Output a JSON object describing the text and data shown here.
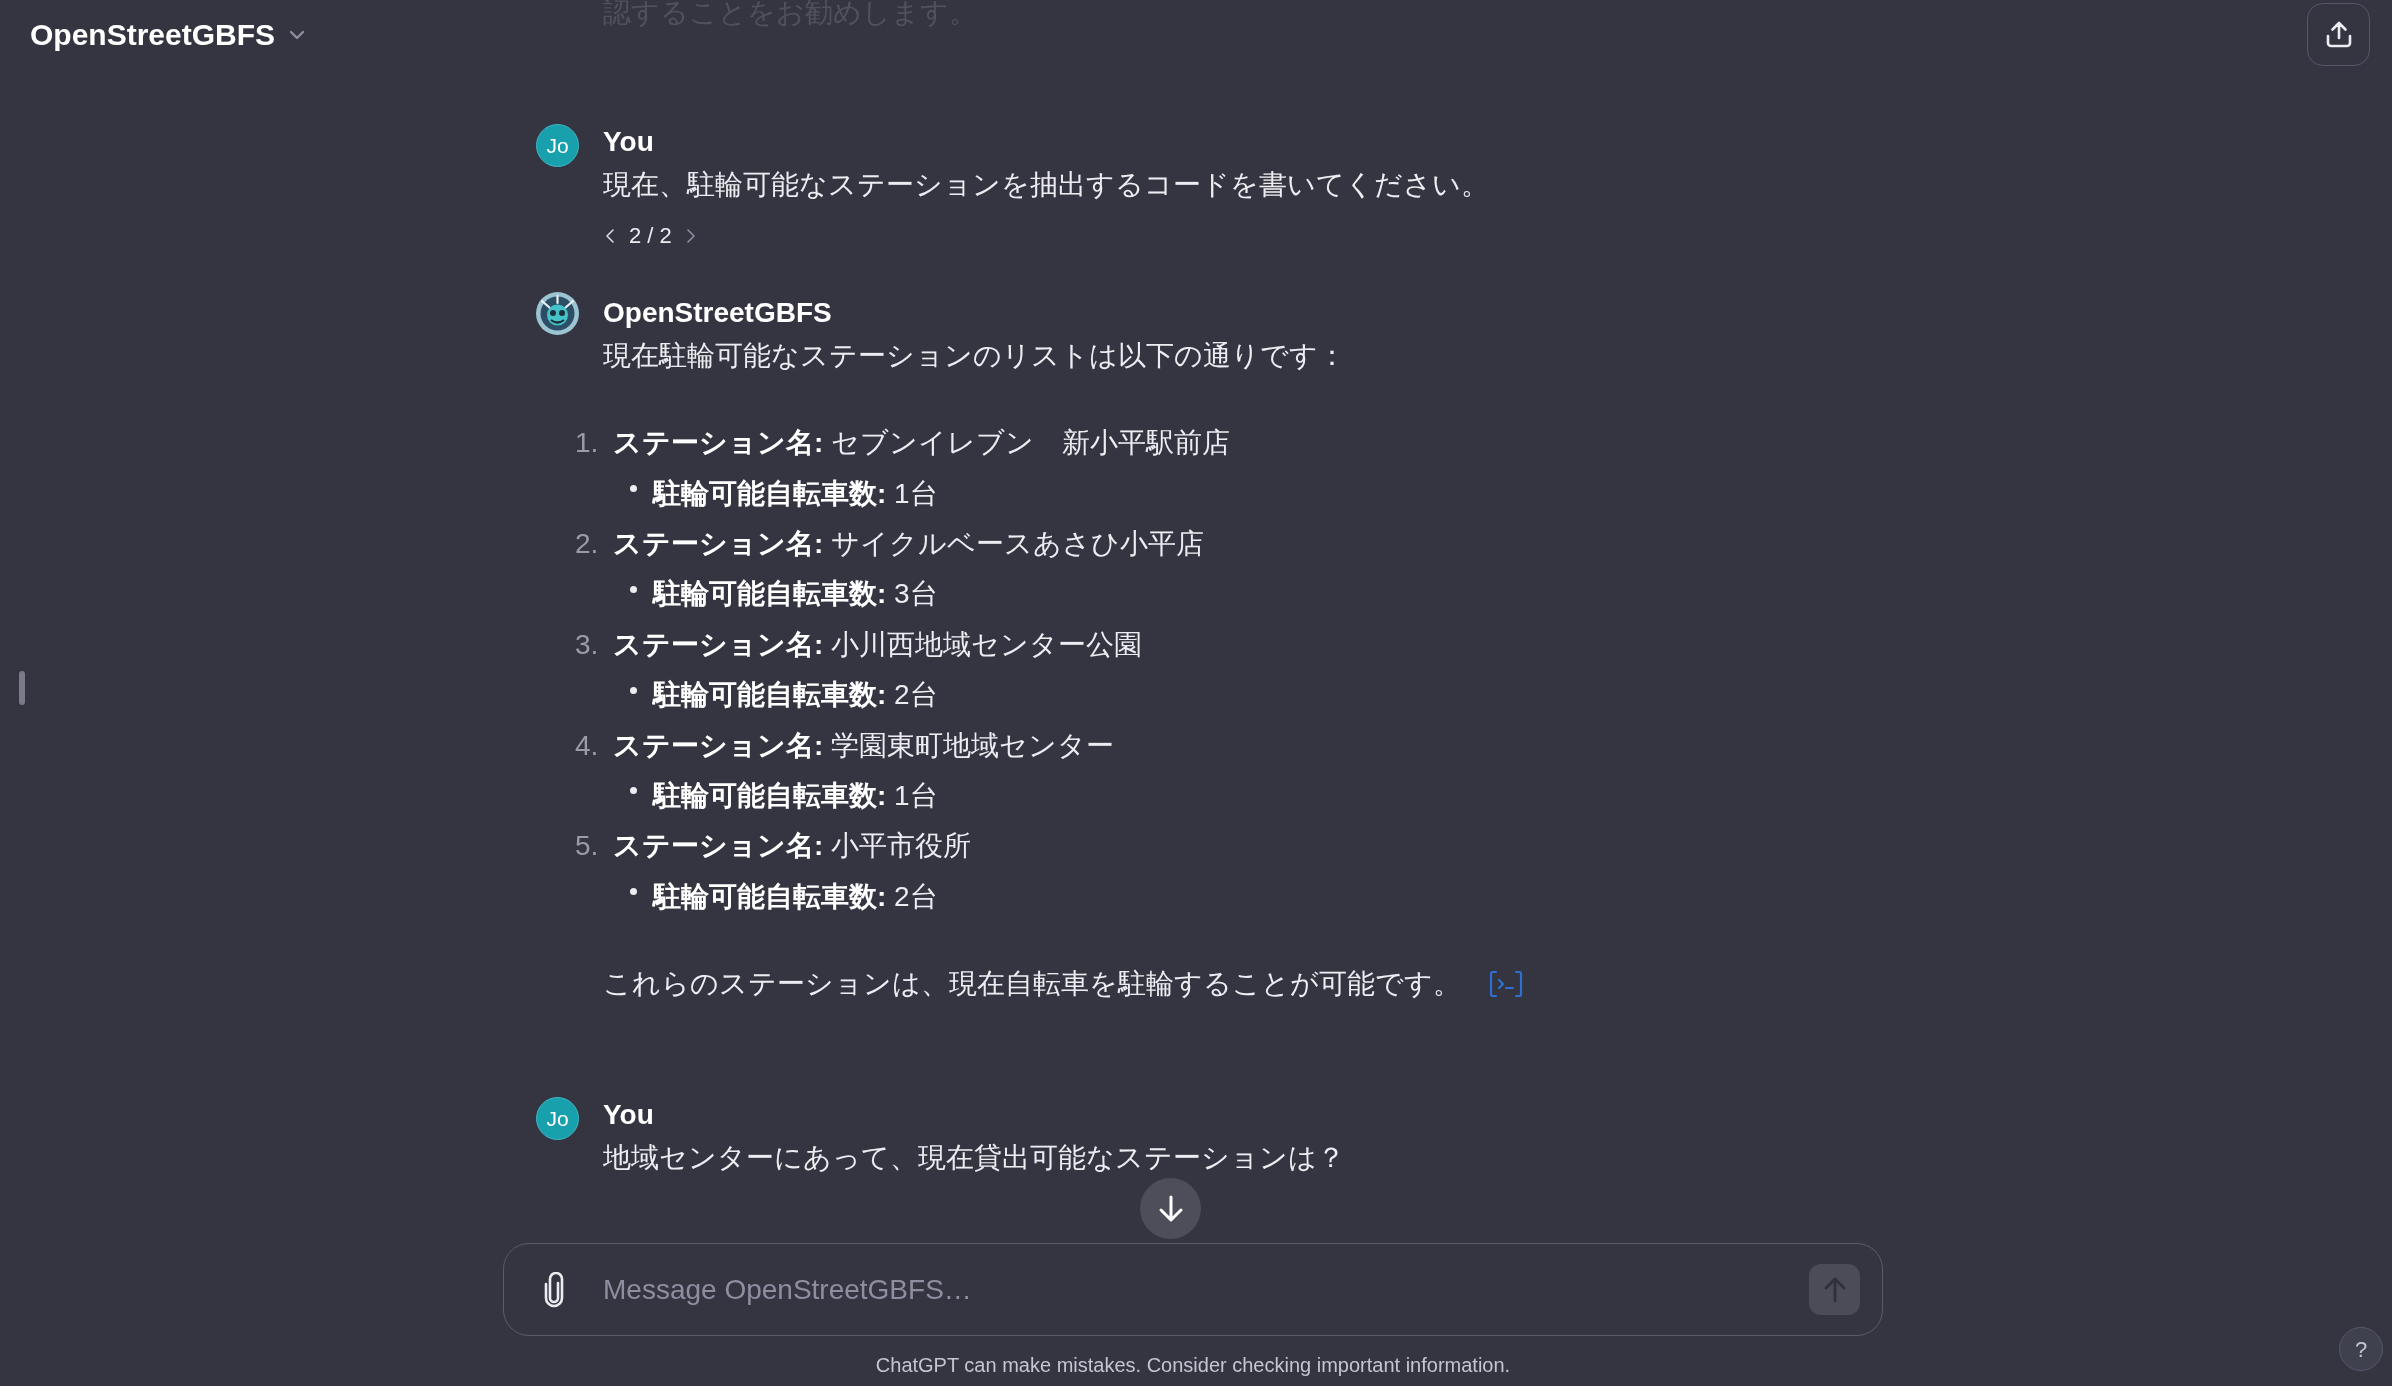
{
  "header": {
    "title": "OpenStreetGBFS"
  },
  "conversation": {
    "scrolled_text": "認することをお勧めします。",
    "messages": [
      {
        "kind": "user",
        "avatar": "Jo",
        "author": "You",
        "text": "現在、駐輪可能なステーションを抽出するコードを書いてください。",
        "pager": {
          "label": "2 / 2",
          "previous": {
            "disabled": false
          },
          "next": {
            "disabled": true
          }
        }
      },
      {
        "kind": "assistant",
        "author": "OpenStreetGBFS",
        "intro": "現在駐輪可能なステーションのリストは以下の通りです：",
        "list": [
          {
            "number": "1.",
            "text": "**ステーション名:** セブンイレブン　新小平駅前店",
            "children": [
              {
                "text": "**駐輪可能自転車数:** 1台"
              }
            ]
          },
          {
            "number": "2.",
            "text": "**ステーション名:** サイクルベースあさひ小平店",
            "children": [
              {
                "text": "**駐輪可能自転車数:** 3台"
              }
            ]
          },
          {
            "number": "3.",
            "text": "**ステーション名:** 小川西地域センター公園",
            "children": [
              {
                "text": "**駐輪可能自転車数:** 2台"
              }
            ]
          },
          {
            "number": "4.",
            "text": "**ステーション名:** 学園東町地域センター",
            "children": [
              {
                "text": "**駐輪可能自転車数:** 1台"
              }
            ]
          },
          {
            "number": "5.",
            "text": "**ステーション名:** 小平市役所",
            "children": [
              {
                "text": "**駐輪可能自転車数:** 2台"
              }
            ]
          }
        ],
        "outro": "これらのステーションは、現在自転車を駐輪することが可能です。"
      },
      {
        "kind": "user",
        "avatar": "Jo",
        "author": "You",
        "text": "地域センターにあって、現在貸出可能なステーションは？"
      }
    ]
  },
  "composer": {
    "placeholder": "Message OpenStreetGBFS…",
    "send_disabled": true
  },
  "disclaimer": "ChatGPT can make mistakes. Consider checking important information.",
  "help_button": {
    "label": "?"
  }
}
